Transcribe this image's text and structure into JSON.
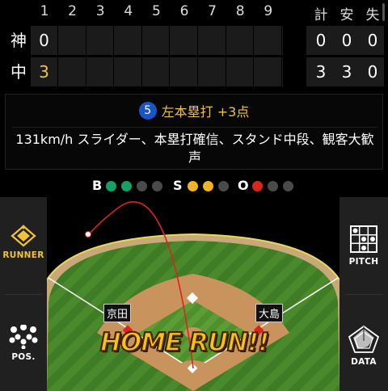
{
  "scoreboard": {
    "innings": [
      "1",
      "2",
      "3",
      "4",
      "5",
      "6",
      "7",
      "8",
      "9"
    ],
    "totals_headers": [
      "計",
      "安",
      "失"
    ],
    "teams": [
      {
        "label": "神",
        "innings": [
          "0",
          "",
          "",
          "",
          "",
          "",
          "",
          "",
          ""
        ],
        "totals": [
          "0",
          "0",
          "0"
        ]
      },
      {
        "label": "中",
        "innings": [
          "3",
          "",
          "",
          "",
          "",
          "",
          "",
          "",
          ""
        ],
        "totals": [
          "3",
          "3",
          "0"
        ]
      }
    ]
  },
  "play": {
    "number": "5",
    "title": "左本塁打 +3点",
    "description": "131km/h スライダー、本塁打確信、スタンド中段、観客大歓声"
  },
  "count": {
    "ball_label": "B",
    "strike_label": "S",
    "out_label": "O",
    "balls_lit": 2,
    "strikes_lit": 2,
    "outs_lit": 1,
    "colors": {
      "ball": "#15a06a",
      "strike": "#f0b323",
      "out": "#d9261c",
      "off": "#4a4a4a"
    }
  },
  "field": {
    "runner_third": "京田",
    "runner_first": "大島",
    "banner": "HOME RUN!!"
  },
  "left_nav": [
    {
      "label": "RUNNER",
      "icon": "runner-diamond-icon",
      "active": true
    },
    {
      "label": "POS.",
      "icon": "positions-icon",
      "active": false
    }
  ],
  "right_nav": [
    {
      "label": "PITCH",
      "icon": "pitch-grid-icon"
    },
    {
      "label": "DATA",
      "icon": "data-radar-icon"
    }
  ]
}
